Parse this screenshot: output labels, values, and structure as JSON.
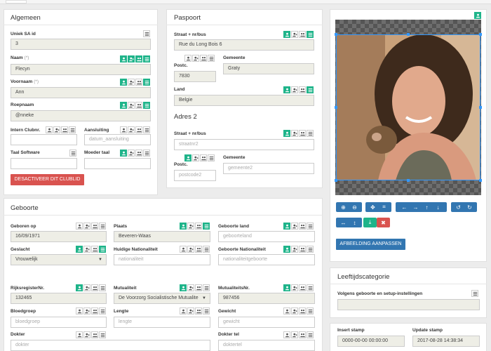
{
  "algemeen": {
    "title": "Algemeen",
    "uniek_label": "Uniek SA id",
    "uniek_value": "3",
    "naam_label": "Naam",
    "naam_value": "Flecyn",
    "voornaam_label": "Voornaam",
    "voornaam_value": "Ann",
    "roepnaam_label": "Roepnaam",
    "roepnaam_value": "@nneke",
    "required_mark": "(*)",
    "intern_label": "Intern Clubnr.",
    "aansluiting_label": "Aansluiting",
    "aansluiting_placeholder": "datum_aansluiting",
    "taal_label": "Taal Software",
    "moeder_label": "Moeder taal",
    "deactivate_button": "DESACTIVEER DIT CLUBLID"
  },
  "paspoort": {
    "title": "Paspoort",
    "straat_label": "Straat + nr/bus",
    "straat_value": "Rue du Long Bois 6",
    "postc_label": "Postc.",
    "postc_value": "7830",
    "gemeente_label": "Gemeente",
    "gemeente_value": "Graty",
    "land_label": "Land",
    "land_value": "Belgie"
  },
  "adres2": {
    "title": "Adres 2",
    "straat_label": "Straat + nr/bus",
    "straat_placeholder": "straatnr2",
    "postc_label": "Postc.",
    "postc_placeholder": "postcode2",
    "gemeente_label": "Gemeente",
    "gemeente_placeholder": "gemeente2"
  },
  "image": {
    "button": "AFBEELDING AANPASSEN"
  },
  "geboorte": {
    "title": "Geboorte",
    "geboren_label": "Geboren op",
    "geboren_value": "16/09/1971",
    "plaats_label": "Plaats",
    "plaats_value": "Beveren-Waas",
    "land_label": "Geboorte land",
    "land_placeholder": "geboorteland",
    "geslacht_label": "Geslacht",
    "geslacht_value": "Vrouwelijk",
    "huidige_label": "Huidige Nationaliteit",
    "huidige_placeholder": "nationaliteit",
    "gebnat_label": "Geboorte Nationaliteit",
    "gebnat_placeholder": "nationaliteitgeboorte",
    "rijks_label": "RijksregisterNr.",
    "rijks_value": "132465",
    "mut_label": "Mutualiteit",
    "mut_value": "De Voorzorg Socialistische Mutualite",
    "mutnr_label": "MutualiteitsNr.",
    "mutnr_value": "987456",
    "bloed_label": "Bloedgroep",
    "bloed_placeholder": "bloedgroep",
    "lengte_label": "Lengte",
    "lengte_placeholder": "lengte",
    "gewicht_label": "Gewicht",
    "gewicht_placeholder": "gewicht",
    "dokter_label": "Dokter",
    "dokter_placeholder": "dokter",
    "doktertel_label": "Dokter tel",
    "doktertel_placeholder": "doktertel"
  },
  "leeftijd": {
    "title": "Leeftijdscategorie",
    "label": "Volgens geboorte en setup-instellingen"
  },
  "stamps": {
    "insert_label": "Insert stamp",
    "insert_value": "0000-00-00 00:00:00",
    "update_label": "Update stamp",
    "update_value": "2017-08-28 14:38:34"
  },
  "colors": {
    "accent": "#1fb48a",
    "primary": "#3276b1",
    "danger": "#d9534f"
  },
  "icons": [
    "person-icon",
    "person-add-icon",
    "group-icon",
    "list-icon"
  ]
}
